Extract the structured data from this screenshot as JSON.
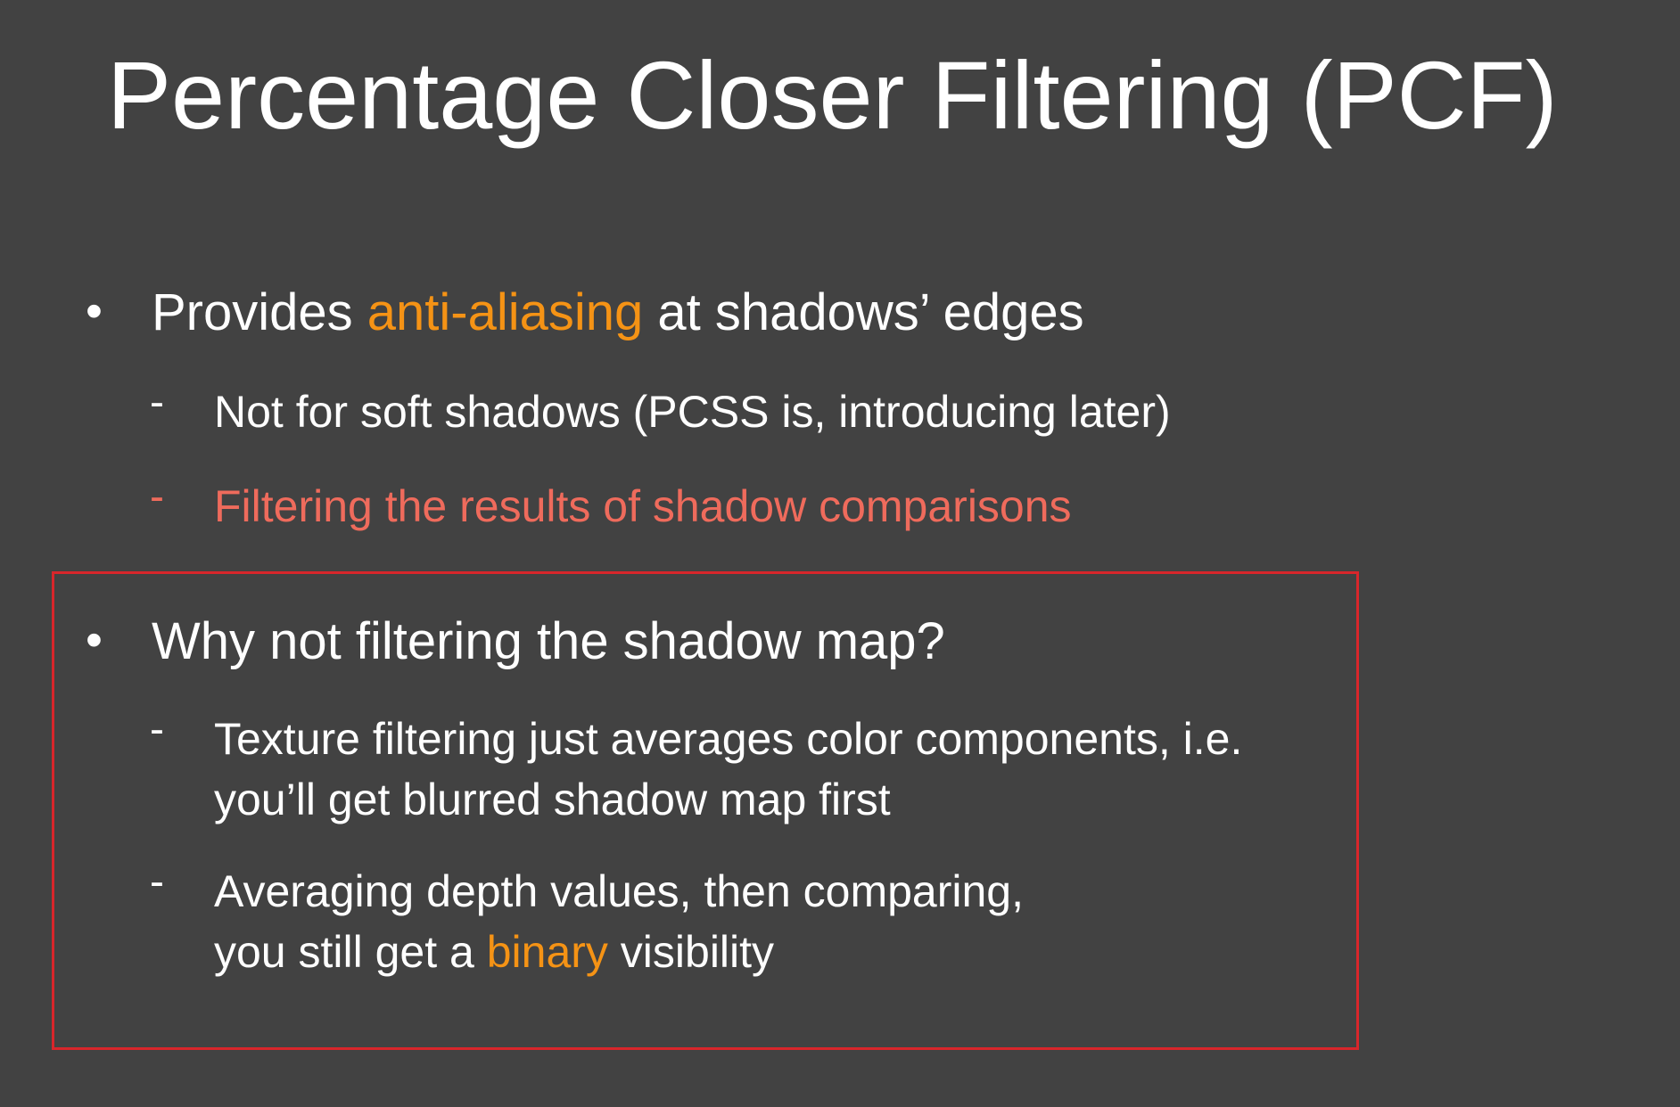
{
  "slide": {
    "title": "Percentage Closer Filtering (PCF)",
    "accent_color": "#f59315",
    "emphasis_color": "#ef6b5c",
    "box_color": "#d8262b",
    "bullet1": {
      "marker": "•",
      "text_pre": "Provides ",
      "text_highlight": "anti-aliasing",
      "text_post": " at shadows’ edges",
      "subs": [
        {
          "marker": "-",
          "text": "Not for soft shadows (PCSS is, introducing later)"
        },
        {
          "marker": "-",
          "text": "Filtering the results of shadow comparisons"
        }
      ]
    },
    "bullet2": {
      "marker": "•",
      "text": "Why not filtering the shadow map?",
      "subs": [
        {
          "marker": "-",
          "line1": "Texture filtering just averages color components, i.e.",
          "line2": "you’ll get blurred shadow map first"
        },
        {
          "marker": "-",
          "line1": "Averaging depth values, then comparing,",
          "line2_pre": "you still get a ",
          "line2_highlight": "binary",
          "line2_post": " visibility"
        }
      ]
    }
  }
}
